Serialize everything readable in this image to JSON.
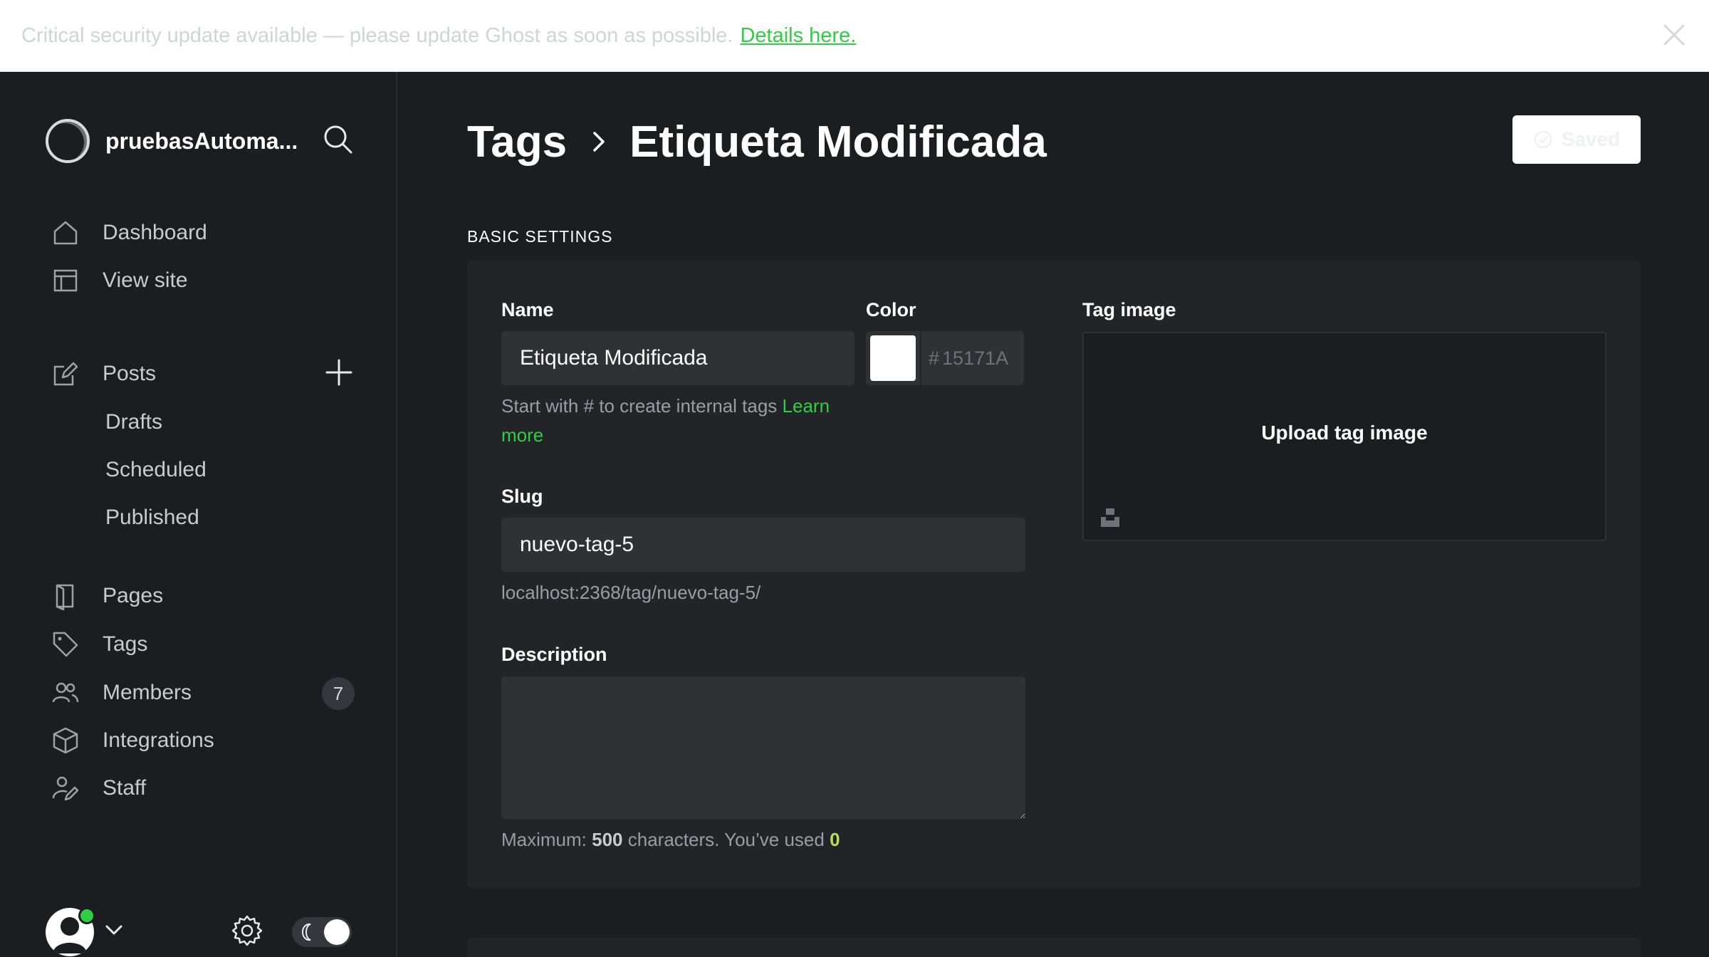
{
  "banner": {
    "message": "Critical security update available — please update Ghost as soon as possible.",
    "link": "Details here."
  },
  "sidebar": {
    "site_title": "pruebasAutoma...",
    "nav": {
      "dashboard": "Dashboard",
      "view_site": "View site",
      "posts": "Posts",
      "drafts": "Drafts",
      "scheduled": "Scheduled",
      "published": "Published",
      "pages": "Pages",
      "tags": "Tags",
      "members": "Members",
      "members_count": "7",
      "integrations": "Integrations",
      "staff": "Staff"
    }
  },
  "header": {
    "breadcrumb_parent": "Tags",
    "breadcrumb_current": "Etiqueta Modificada",
    "save_button": "Saved"
  },
  "form": {
    "section_title": "BASIC SETTINGS",
    "name_label": "Name",
    "name_value": "Etiqueta Modificada",
    "name_hint": "Start with # to create internal tags",
    "name_hint_link": "Learn more",
    "color_label": "Color",
    "color_value": "#ffffff",
    "color_hex_hash": "#",
    "color_hex_placeholder": "15171A",
    "slug_label": "Slug",
    "slug_value": "nuevo-tag-5",
    "slug_url": "localhost:2368/tag/nuevo-tag-5/",
    "description_label": "Description",
    "description_value": "",
    "desc_hint_prefix": "Maximum:",
    "desc_hint_max": "500",
    "desc_hint_mid": "characters. You’ve used",
    "desc_hint_used": "0",
    "tag_image_label": "Tag image",
    "upload_label": "Upload tag image"
  },
  "colors": {
    "accent_green": "#30cf43",
    "background": "#1c1d20",
    "panel": "#232428",
    "input": "#303135"
  }
}
